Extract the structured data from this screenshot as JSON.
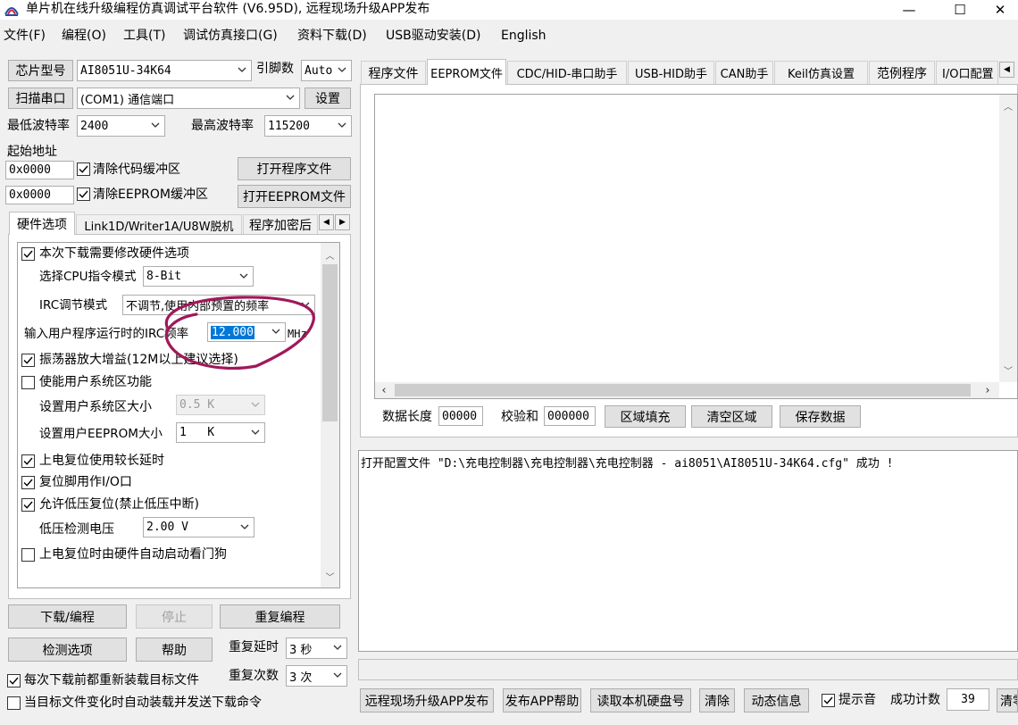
{
  "window": {
    "title": "单片机在线升级编程仿真调试平台软件 (V6.95D), 远程现场升级APP发布",
    "minimize": "—",
    "maximize": "☐",
    "close": "✕"
  },
  "menu": [
    "文件(F)",
    "编程(O)",
    "工具(T)",
    "调试仿真接口(G)",
    "资料下载(D)",
    "USB驱动安装(D)",
    "English"
  ],
  "left": {
    "chip_button": "芯片型号",
    "chip_value": "AI8051U-34K64",
    "pin_label": "引脚数",
    "pin_value": "Auto",
    "scan_button": "扫描串口",
    "port_value": "(COM1) 通信端口",
    "settings_button": "设置",
    "min_baud_label": "最低波特率",
    "min_baud_value": "2400",
    "max_baud_label": "最高波特率",
    "max_baud_value": "115200",
    "start_addr_label": "起始地址",
    "code_addr": "0x0000",
    "clear_code_label": "清除代码缓冲区",
    "open_program_button": "打开程序文件",
    "eeprom_addr": "0x0000",
    "clear_eeprom_label": "清除EEPROM缓冲区",
    "open_eeprom_button": "打开EEPROM文件",
    "tabs": [
      "硬件选项",
      "Link1D/Writer1A/U8W脱机",
      "程序加密后"
    ],
    "options": {
      "modify_hw": "本次下载需要修改硬件选项",
      "cpu_mode_label": "选择CPU指令模式",
      "cpu_mode_value": "8-Bit",
      "irc_mode_label": "IRC调节模式",
      "irc_mode_value": "不调节,使用内部预置的频率",
      "irc_freq_label": "输入用户程序运行时的IRC频率",
      "irc_freq_value": "12.000",
      "irc_freq_unit": "MHz",
      "osc_gain": "振荡器放大增益(12M以上建议选择)",
      "user_sys_area": "使能用户系统区功能",
      "sys_area_size_label": "设置用户系统区大小",
      "sys_area_size_value": "0.5 K",
      "eeprom_size_label": "设置用户EEPROM大小",
      "eeprom_size_value": "1   K",
      "power_reset_delay": "上电复位使用较长延时",
      "reset_pin_io": "复位脚用作I/O口",
      "low_volt_reset": "允许低压复位(禁止低压中断)",
      "low_volt_label": "低压检测电压",
      "low_volt_value": "2.00 V",
      "watchdog": "上电复位时由硬件自动启动看门狗"
    },
    "download_button": "下载/编程",
    "stop_button": "停止",
    "reprogram_button": "重复编程",
    "detect_button": "检测选项",
    "help_button": "帮助",
    "repeat_delay_label": "重复延时",
    "repeat_delay_value": "3 秒",
    "repeat_count_label": "重复次数",
    "repeat_count_value": "3 次",
    "reload_label": "每次下载前都重新装载目标文件",
    "auto_load_label": "当目标文件变化时自动装载并发送下载命令"
  },
  "right": {
    "tabs": [
      "程序文件",
      "EEPROM文件",
      "CDC/HID-串口助手",
      "USB-HID助手",
      "CAN助手",
      "Keil仿真设置",
      "范例程序",
      "I/O口配置"
    ],
    "data_length_label": "数据长度",
    "data_length_value": "00000",
    "checksum_label": "校验和",
    "checksum_value": "000000",
    "fill_button": "区域填充",
    "clear_area_button": "清空区域",
    "save_data_button": "保存数据",
    "log_text": "打开配置文件 \"D:\\充电控制器\\充电控制器\\充电控制器 - ai8051\\AI8051U-34K64.cfg\" 成功 !",
    "remote_button": "远程现场升级APP发布",
    "app_help_button": "发布APP帮助",
    "read_disk_button": "读取本机硬盘号",
    "clear_button": "清除",
    "dynamic_button": "动态信息",
    "sound_label": "提示音",
    "success_label": "成功计数",
    "success_value": "39",
    "clear_count_button": "清零"
  },
  "colors": {
    "annotation": "#a0185a",
    "selection": "#0078d7",
    "background": "#f0f0f0"
  }
}
